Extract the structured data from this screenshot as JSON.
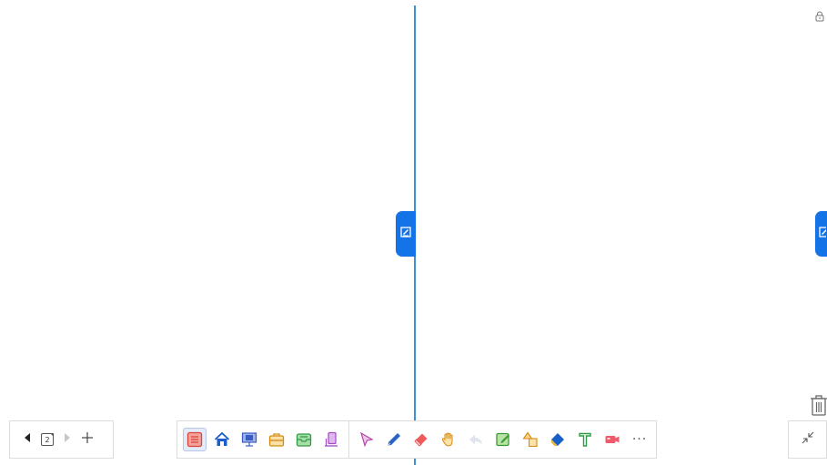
{
  "page_nav": {
    "current_page": "2"
  },
  "main_toolbar": {
    "more_label": "···"
  },
  "colors": {
    "accent": "#1473e6",
    "divider": "#3f8fd8"
  },
  "icons": {
    "left_group": [
      "list-icon",
      "home-icon",
      "presentation-icon",
      "toolbox-icon",
      "tray-icon",
      "clipboard-icon"
    ],
    "right_group": [
      "select-arrow-icon",
      "pen-icon",
      "eraser-icon",
      "hand-icon",
      "undo-icon",
      "note-edit-icon",
      "shapes-icon",
      "fill-icon",
      "text-icon",
      "record-icon",
      "more-icon"
    ]
  }
}
